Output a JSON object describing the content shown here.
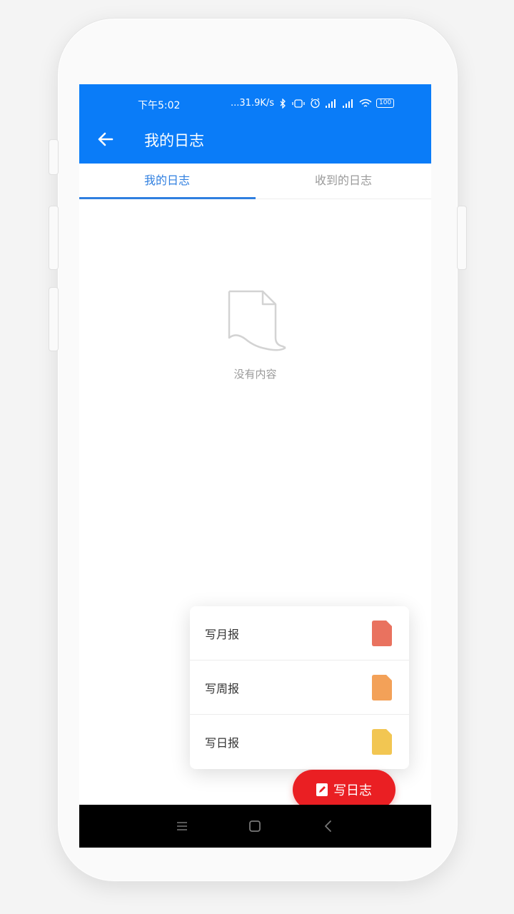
{
  "status_bar": {
    "time": "下午5:02",
    "net_speed": "...31.9K/s",
    "battery": "100"
  },
  "app_bar": {
    "title": "我的日志"
  },
  "tabs": [
    {
      "label": "我的日志",
      "active": true
    },
    {
      "label": "收到的日志",
      "active": false
    }
  ],
  "empty_state": {
    "text": "没有内容"
  },
  "menu": {
    "items": [
      {
        "label": "写月报",
        "icon": "doc-icon",
        "color": "#e9725f"
      },
      {
        "label": "写周报",
        "icon": "doc-icon",
        "color": "#f3a158"
      },
      {
        "label": "写日报",
        "icon": "doc-icon",
        "color": "#f2c652"
      }
    ]
  },
  "fab": {
    "label": "写日志",
    "color": "#ea1f23"
  },
  "colors": {
    "primary": "#0a7cf8",
    "tab_active": "#2f7fe0"
  }
}
